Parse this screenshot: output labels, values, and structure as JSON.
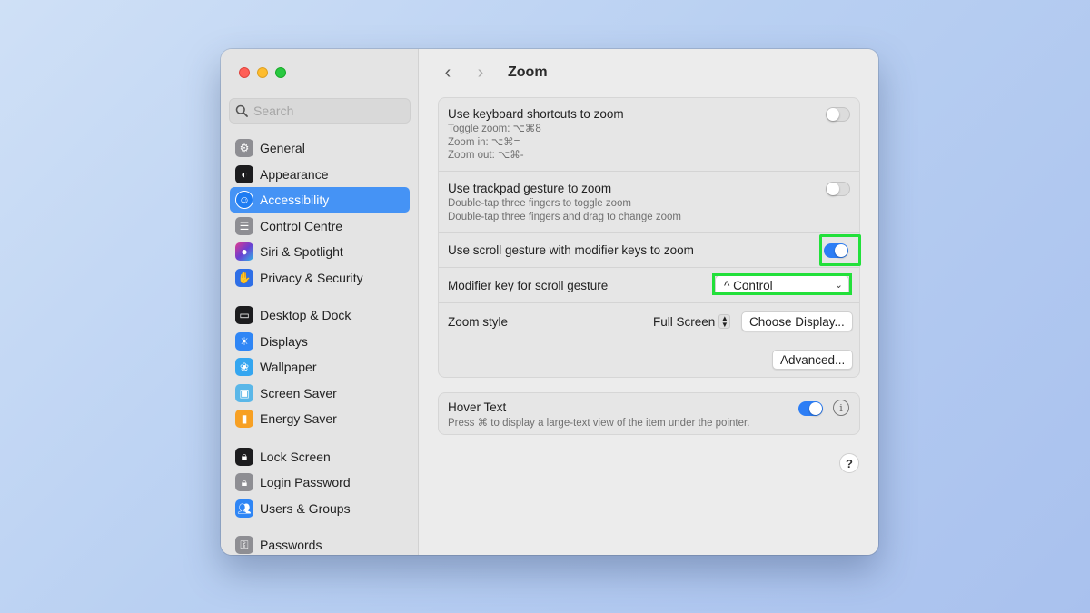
{
  "sidebar": {
    "search_placeholder": "Search",
    "items": [
      {
        "label": "General",
        "icon": "gear-icon",
        "color": "#8e8e93"
      },
      {
        "label": "Appearance",
        "icon": "appearance-icon",
        "color": "#1c1c1e"
      },
      {
        "label": "Accessibility",
        "icon": "accessibility-icon",
        "color": "#1e7cf2",
        "active": true
      },
      {
        "label": "Control Centre",
        "icon": "control-centre-icon",
        "color": "#8e8e93"
      },
      {
        "label": "Siri & Spotlight",
        "icon": "siri-icon",
        "color": "#6b3fd1"
      },
      {
        "label": "Privacy & Security",
        "icon": "hand-icon",
        "color": "#2f6fe6"
      },
      {
        "label": "Desktop & Dock",
        "icon": "dock-icon",
        "color": "#1c1c1e"
      },
      {
        "label": "Displays",
        "icon": "displays-icon",
        "color": "#2f86f5"
      },
      {
        "label": "Wallpaper",
        "icon": "wallpaper-icon",
        "color": "#34a6f0"
      },
      {
        "label": "Screen Saver",
        "icon": "screensaver-icon",
        "color": "#5ab7e8"
      },
      {
        "label": "Energy Saver",
        "icon": "battery-icon",
        "color": "#f7a023"
      },
      {
        "label": "Lock Screen",
        "icon": "lock-icon",
        "color": "#1c1c1e"
      },
      {
        "label": "Login Password",
        "icon": "padlock-icon",
        "color": "#8e8e93"
      },
      {
        "label": "Users & Groups",
        "icon": "users-icon",
        "color": "#2f86f5"
      },
      {
        "label": "Passwords",
        "icon": "key-icon",
        "color": "#8e8e93"
      }
    ]
  },
  "header": {
    "title": "Zoom"
  },
  "zoom": {
    "keyboard": {
      "title": "Use keyboard shortcuts to zoom",
      "toggle_line": "Toggle zoom: ⌥⌘8",
      "in_line": "Zoom in: ⌥⌘=",
      "out_line": "Zoom out: ⌥⌘-",
      "enabled": false
    },
    "trackpad": {
      "title": "Use trackpad gesture to zoom",
      "line1": "Double-tap three fingers to toggle zoom",
      "line2": "Double-tap three fingers and drag to change zoom",
      "enabled": false
    },
    "scroll": {
      "title": "Use scroll gesture with modifier keys to zoom",
      "enabled": true
    },
    "modifier": {
      "label": "Modifier key for scroll gesture",
      "value": "^ Control"
    },
    "style": {
      "label": "Zoom style",
      "value": "Full Screen",
      "choose_label": "Choose Display..."
    },
    "advanced_label": "Advanced..."
  },
  "hover": {
    "title": "Hover Text",
    "subtitle": "Press ⌘ to display a large-text view of the item under the pointer.",
    "enabled": true
  },
  "help_label": "?",
  "colors": {
    "accent": "#2d7ef5",
    "highlight": "#22e03a",
    "selection": "#4593f5"
  }
}
